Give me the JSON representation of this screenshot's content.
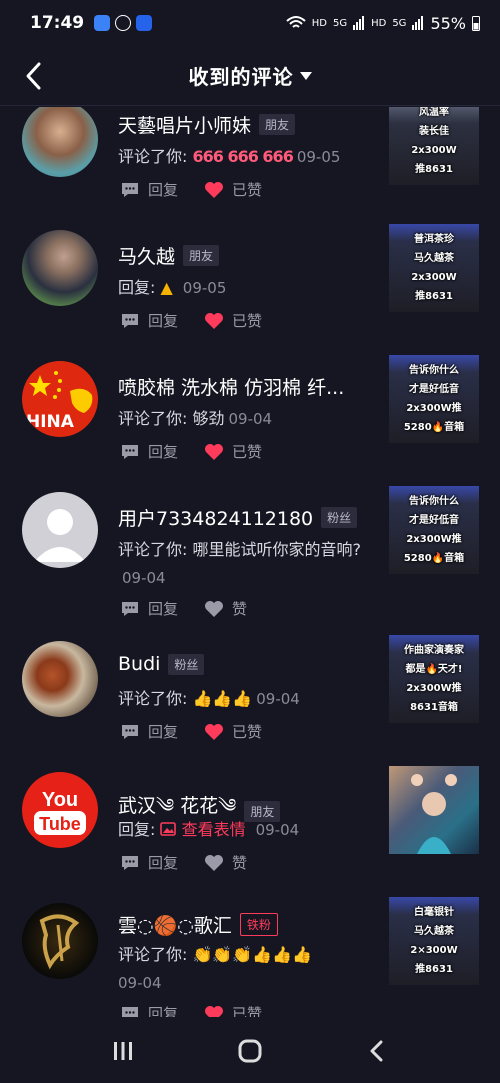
{
  "status": {
    "time": "17:49",
    "signal_labels": [
      "HD",
      "5G",
      "HD",
      "5G"
    ],
    "battery": "55%"
  },
  "header": {
    "title": "收到的评论"
  },
  "items": [
    {
      "name": "天藝唱片小师妹",
      "badge": "朋友",
      "prefix": "评论了你: ",
      "text": "",
      "emoji": "666 666 666",
      "date": "09-05",
      "reply_label": "回复",
      "like_label": "已赞",
      "liked": true,
      "thumb_lines": [
        "风温率",
        "装长佳",
        "2x300W",
        "推8631"
      ]
    },
    {
      "name": "马久越",
      "badge": "朋友",
      "prefix": "回复: ",
      "text": "",
      "emoji": "",
      "date": "09-05",
      "reply_label": "回复",
      "like_label": "已赞",
      "liked": true,
      "thumb_lines": [
        "普洱茶珍",
        "马久越茶",
        "2x300W",
        "推8631"
      ]
    },
    {
      "name": "喷胶棉 洗水棉 仿羽棉 纤...",
      "badge": "",
      "prefix": "评论了你: ",
      "text": "够劲",
      "emoji": "",
      "date": "09-04",
      "reply_label": "回复",
      "like_label": "已赞",
      "liked": true,
      "thumb_lines": [
        "告诉你什么",
        "才是好低音",
        "2x300W推",
        "5280🔥音箱"
      ]
    },
    {
      "name": "用户7334824112180",
      "badge": "粉丝",
      "prefix": "评论了你: ",
      "text": "哪里能试听你家的音响?",
      "emoji": "",
      "date": "09-04",
      "reply_label": "回复",
      "like_label": "赞",
      "liked": false,
      "thumb_lines": [
        "告诉你什么",
        "才是好低音",
        "2x300W推",
        "5280🔥音箱"
      ]
    },
    {
      "name": "Budi",
      "badge": "粉丝",
      "prefix": "评论了你: ",
      "text": "",
      "emoji": "👍👍👍",
      "date": "09-04",
      "reply_label": "回复",
      "like_label": "已赞",
      "liked": true,
      "thumb_lines": [
        "作曲家演奏家",
        "都是🔥天才!",
        "2x300W推",
        "8631音箱"
      ]
    },
    {
      "name": "武汉༄ 花花༄",
      "badge": "朋友",
      "prefix": "回复: ",
      "text": "",
      "emoji": "",
      "sticker_label": "查看表情",
      "date": "09-04",
      "reply_label": "回复",
      "like_label": "赞",
      "liked": false,
      "thumb_lines": []
    },
    {
      "name": "雲◌🏀◌歌汇",
      "badge": "铁粉",
      "prefix": "评论了你: ",
      "text": "",
      "emoji": "👏👏👏👍👍👍",
      "date": "09-04",
      "reply_label": "回复",
      "like_label": "已赞",
      "liked": true,
      "thumb_lines": [
        "白毫银针",
        "马久越茶",
        "2×300W",
        "推8631"
      ]
    }
  ],
  "colors": {
    "background": "#161622",
    "accent": "#ff3b5c",
    "muted": "#9a9aa8"
  },
  "avatar_texts": {
    "hina": "HINA",
    "you": "You",
    "tube": "Tube"
  },
  "icons": {
    "reply": "comment-bubble-icon",
    "like": "heart-icon",
    "back": "chevron-left-icon"
  }
}
